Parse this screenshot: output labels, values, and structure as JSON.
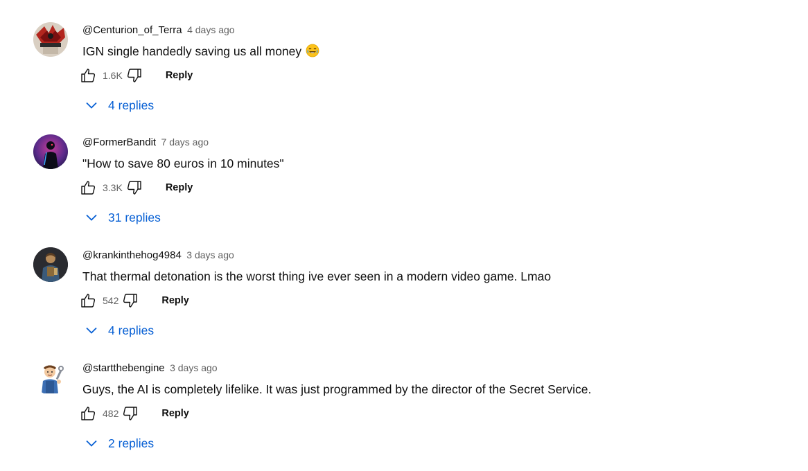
{
  "comments": [
    {
      "author": "@Centurion_of_Terra",
      "time": "4 days ago",
      "text": "IGN single handedly saving us all money",
      "likes": "1.6K",
      "reply_label": "Reply",
      "replies_label": "4 replies",
      "avatar_icon": "red-warrior-avatar",
      "emoji": "laughing-emoji"
    },
    {
      "author": "@FormerBandit",
      "time": "7 days ago",
      "text": "\"How to save 80 euros in 10 minutes\"",
      "likes": "3.3K",
      "reply_label": "Reply",
      "replies_label": "31 replies",
      "avatar_icon": "neon-figure-avatar"
    },
    {
      "author": "@krankinthehog4984",
      "time": "3 days ago",
      "text": "That thermal detonation is the worst thing ive ever seen in a modern video game. Lmao",
      "likes": "542",
      "reply_label": "Reply",
      "replies_label": "4 replies",
      "avatar_icon": "armored-character-avatar"
    },
    {
      "author": "@startthebengine",
      "time": "3 days ago",
      "text": "Guys, the AI is completely lifelike. It was just programmed by the director of the Secret Service.",
      "likes": "482",
      "reply_label": "Reply",
      "replies_label": "2 replies",
      "avatar_icon": "mechanic-cartoon-avatar"
    }
  ],
  "colors": {
    "link": "#065fd4",
    "secondary_text": "#606060",
    "primary_text": "#0f0f0f"
  }
}
